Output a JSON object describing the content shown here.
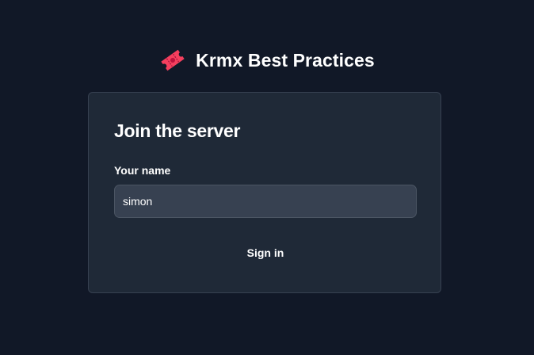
{
  "brand": {
    "title": "Krmx Best Practices",
    "icon": "ticket-icon",
    "icon_color": "#f43f5e"
  },
  "login_card": {
    "title": "Join the server",
    "name_label": "Your name",
    "name_value": "simon",
    "sign_in_label": "Sign in"
  },
  "colors": {
    "background": "#111827",
    "card": "#1f2937",
    "input": "#374151",
    "text": "#ffffff"
  }
}
